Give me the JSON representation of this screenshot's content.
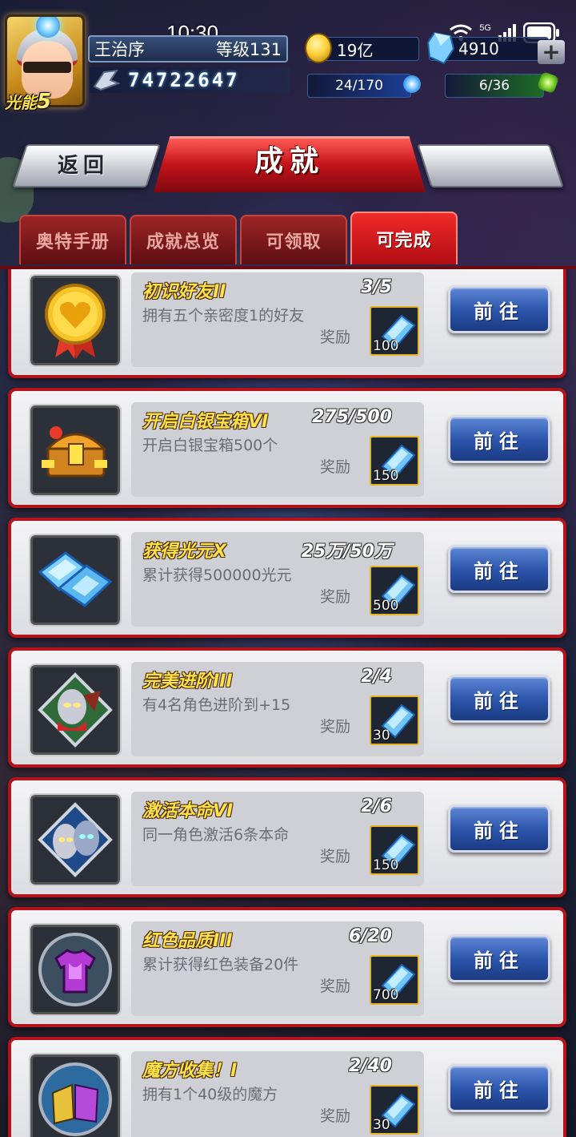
{
  "status": {
    "time": "10:30",
    "network": "5G"
  },
  "player": {
    "name": "王治序",
    "level": "等级131",
    "power": "74722647",
    "light_label": "光能",
    "light_level": "5"
  },
  "resources": {
    "gold": "19亿",
    "diamond": "4910",
    "energy": "24/170",
    "stamina": "6/36"
  },
  "header": {
    "back_label": "返回",
    "title": "成就"
  },
  "tabs": [
    {
      "label": "奥特手册",
      "active": false
    },
    {
      "label": "成就总览",
      "active": false
    },
    {
      "label": "可领取",
      "active": false
    },
    {
      "label": "可完成",
      "active": true
    }
  ],
  "reward_label": "奖励",
  "go_label": "前往",
  "achievements": [
    {
      "title": "初识好友II",
      "progress": "3/5",
      "desc": "拥有五个亲密度1的好友",
      "reward": "100",
      "icon": "heart-medal-icon"
    },
    {
      "title": "开启白银宝箱VI",
      "progress": "275/500",
      "desc": "开启白银宝箱500个",
      "reward": "150",
      "icon": "treasure-chest-icon"
    },
    {
      "title": "获得光元X",
      "progress": "25万/50万",
      "desc": "累计获得500000光元",
      "reward": "500",
      "icon": "crystal-icon"
    },
    {
      "title": "完美进阶III",
      "progress": "2/4",
      "desc": "有4名角色进阶到+15",
      "reward": "30",
      "icon": "hero-upgrade-icon"
    },
    {
      "title": "激活本命VI",
      "progress": "2/6",
      "desc": "同一角色激活6条本命",
      "reward": "150",
      "icon": "hero-pair-icon"
    },
    {
      "title": "红色品质III",
      "progress": "6/20",
      "desc": "累计获得红色装备20件",
      "reward": "700",
      "icon": "armor-icon"
    },
    {
      "title": "魔方收集！I",
      "progress": "2/40",
      "desc": "拥有1个40级的魔方",
      "reward": "30",
      "icon": "cube-icon"
    }
  ]
}
